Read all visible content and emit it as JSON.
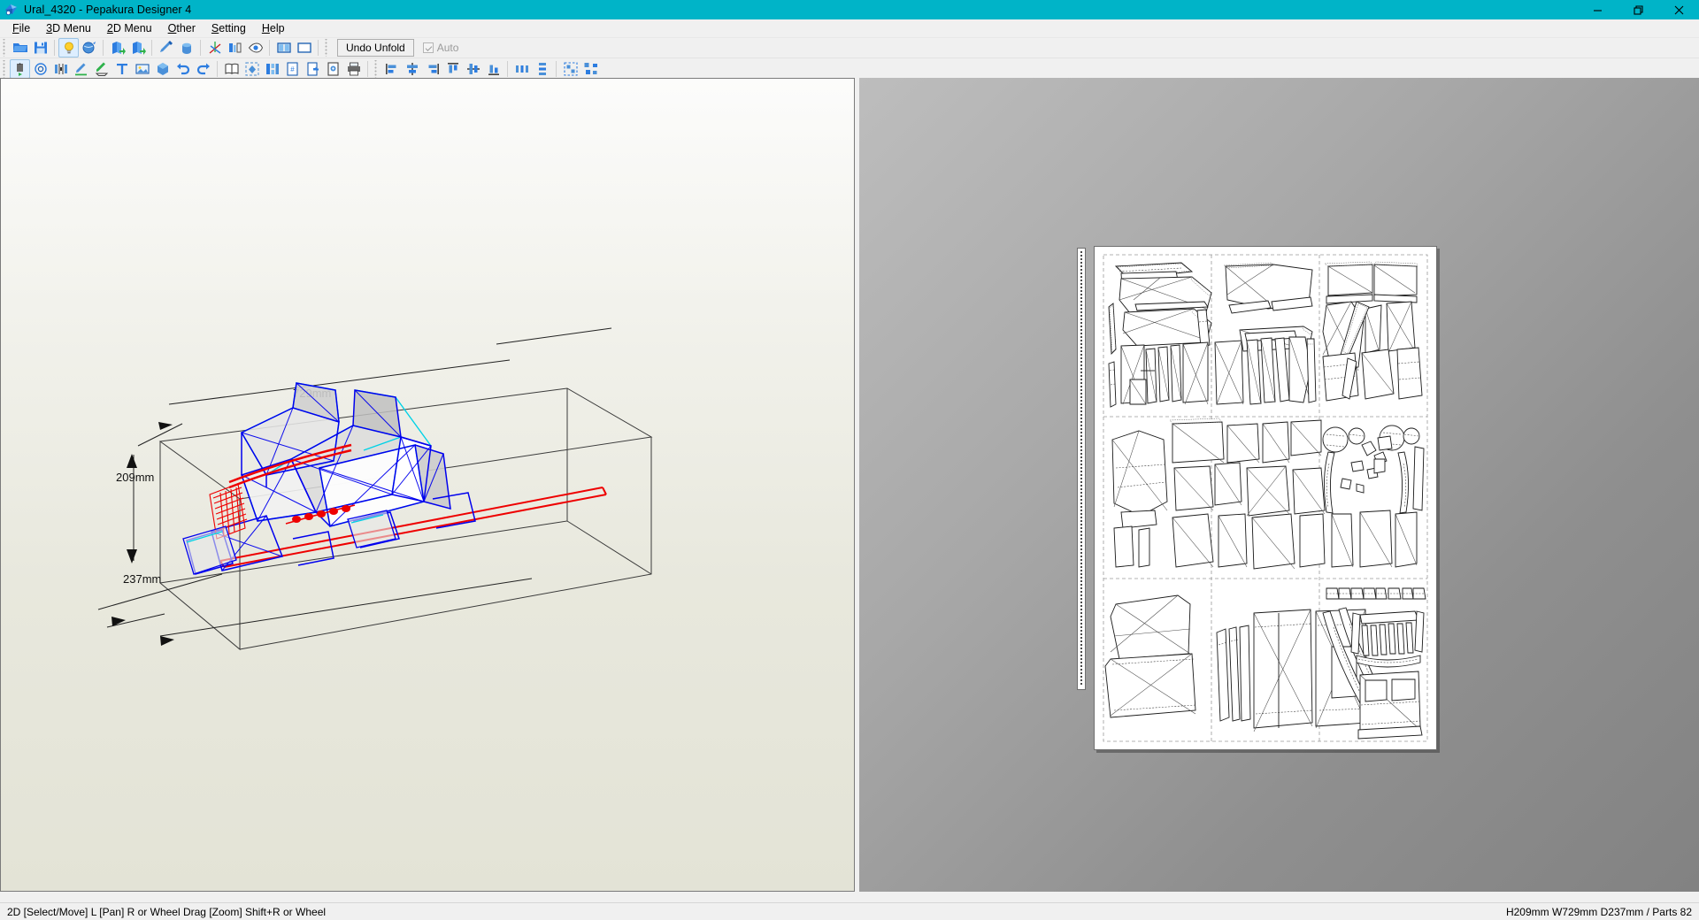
{
  "window": {
    "title": "Ural_4320 - Pepakura Designer 4",
    "icon": "app-icon",
    "controls": [
      {
        "name": "minimize-button",
        "glyph": "minimize"
      },
      {
        "name": "restore-button",
        "glyph": "restore"
      },
      {
        "name": "close-button",
        "glyph": "close"
      }
    ],
    "titlebar_color": "#00b4c8"
  },
  "menubar": {
    "items": [
      {
        "label": "File",
        "accel": "F"
      },
      {
        "label": "3D Menu",
        "accel": "3"
      },
      {
        "label": "2D Menu",
        "accel": "2"
      },
      {
        "label": "Other",
        "accel": "O"
      },
      {
        "label": "Setting",
        "accel": "S"
      },
      {
        "label": "Help",
        "accel": "H"
      }
    ]
  },
  "toolbar_top": {
    "buttons": [
      {
        "name": "open-file-icon",
        "icon": "folder-open"
      },
      {
        "name": "save-file-icon",
        "icon": "floppy-disk"
      },
      {
        "name": "sep",
        "icon": "separator"
      },
      {
        "name": "toggle-light-icon",
        "icon": "lightbulb",
        "active": true
      },
      {
        "name": "texture-paint-icon",
        "icon": "texture-ball"
      },
      {
        "name": "sep",
        "icon": "separator"
      },
      {
        "name": "unfold-left-icon",
        "icon": "unfold-a"
      },
      {
        "name": "unfold-right-icon",
        "icon": "unfold-b"
      },
      {
        "name": "sep",
        "icon": "separator"
      },
      {
        "name": "flatten-brush-icon",
        "icon": "brush"
      },
      {
        "name": "paint-bucket-icon",
        "icon": "bucket"
      },
      {
        "name": "sep",
        "icon": "separator"
      },
      {
        "name": "axis-icon",
        "icon": "axis"
      },
      {
        "name": "compare-view-icon",
        "icon": "compare"
      },
      {
        "name": "preview-eye-icon",
        "icon": "eye"
      },
      {
        "name": "sep",
        "icon": "separator"
      },
      {
        "name": "split-view-icon",
        "icon": "split-vertical"
      },
      {
        "name": "single-view-icon",
        "icon": "single-pane"
      }
    ],
    "undo_unfold_label": "Undo Unfold",
    "auto_label": "Auto",
    "auto_checked": true,
    "auto_enabled": false
  },
  "toolbar_bottom": {
    "buttons": [
      {
        "name": "select-move-icon",
        "icon": "select-move",
        "active": true
      },
      {
        "name": "rotate-part-icon",
        "icon": "rotate-part"
      },
      {
        "name": "join-divide-icon",
        "icon": "join-divide"
      },
      {
        "name": "edge-edit-icon",
        "icon": "pencil-green"
      },
      {
        "name": "flap-edit-icon",
        "icon": "flap"
      },
      {
        "name": "add-text-icon",
        "icon": "text-T"
      },
      {
        "name": "add-image-icon",
        "icon": "image"
      },
      {
        "name": "show-3d-icon",
        "icon": "cube"
      },
      {
        "name": "undo-icon",
        "icon": "undo-arrow"
      },
      {
        "name": "redo-icon",
        "icon": "redo-arrow"
      },
      {
        "name": "sep",
        "icon": "separator"
      },
      {
        "name": "unfold-book-icon",
        "icon": "book"
      },
      {
        "name": "fit-page-icon",
        "icon": "fit-page"
      },
      {
        "name": "layout-parts-icon",
        "icon": "layout-parts"
      },
      {
        "name": "page-number-icon",
        "icon": "page-hash"
      },
      {
        "name": "add-page-icon",
        "icon": "page-add"
      },
      {
        "name": "page-settings-icon",
        "icon": "page-settings"
      },
      {
        "name": "print-icon",
        "icon": "printer"
      },
      {
        "name": "sep",
        "icon": "separator"
      },
      {
        "name": "align-left-icon",
        "icon": "align-left"
      },
      {
        "name": "align-center-icon",
        "icon": "align-center"
      },
      {
        "name": "align-right-icon",
        "icon": "align-right"
      },
      {
        "name": "align-top-icon",
        "icon": "align-top"
      },
      {
        "name": "align-middle-icon",
        "icon": "align-middle"
      },
      {
        "name": "align-bottom-icon",
        "icon": "align-bottom"
      },
      {
        "name": "sep",
        "icon": "separator"
      },
      {
        "name": "distribute-h-icon",
        "icon": "distribute-h"
      },
      {
        "name": "distribute-v-icon",
        "icon": "distribute-v"
      },
      {
        "name": "sep",
        "icon": "separator"
      },
      {
        "name": "group-parts-icon",
        "icon": "group-parts"
      },
      {
        "name": "scatter-parts-icon",
        "icon": "scatter-parts"
      }
    ]
  },
  "view3d": {
    "model_name": "Ural_4320",
    "dimensions": {
      "width_label": "729mm",
      "height_label": "209mm",
      "depth_label": "237mm"
    },
    "colors": {
      "edge_blue": "#0000ee",
      "edge_cyan": "#00d8e8",
      "edge_red": "#ee0000",
      "face_gray": "#c8c8c8",
      "face_white": "#ffffff",
      "bbox_line": "#333333",
      "background_top": "#fcfcfb",
      "background_bottom": "#e3e3d6"
    }
  },
  "view2d": {
    "background_color": "#a8a8a8",
    "sheet_color": "#ffffff",
    "cut_line_color": "#1a1a1a",
    "fold_line_color": "#555555",
    "page_divider_color": "#9a9a9a",
    "pages_across": 3,
    "pages_down": 3
  },
  "statusbar": {
    "hint": "2D [Select/Move] L [Pan] R or Wheel Drag [Zoom] Shift+R or Wheel",
    "model_info": "H209mm W729mm D237mm / Parts 82"
  }
}
